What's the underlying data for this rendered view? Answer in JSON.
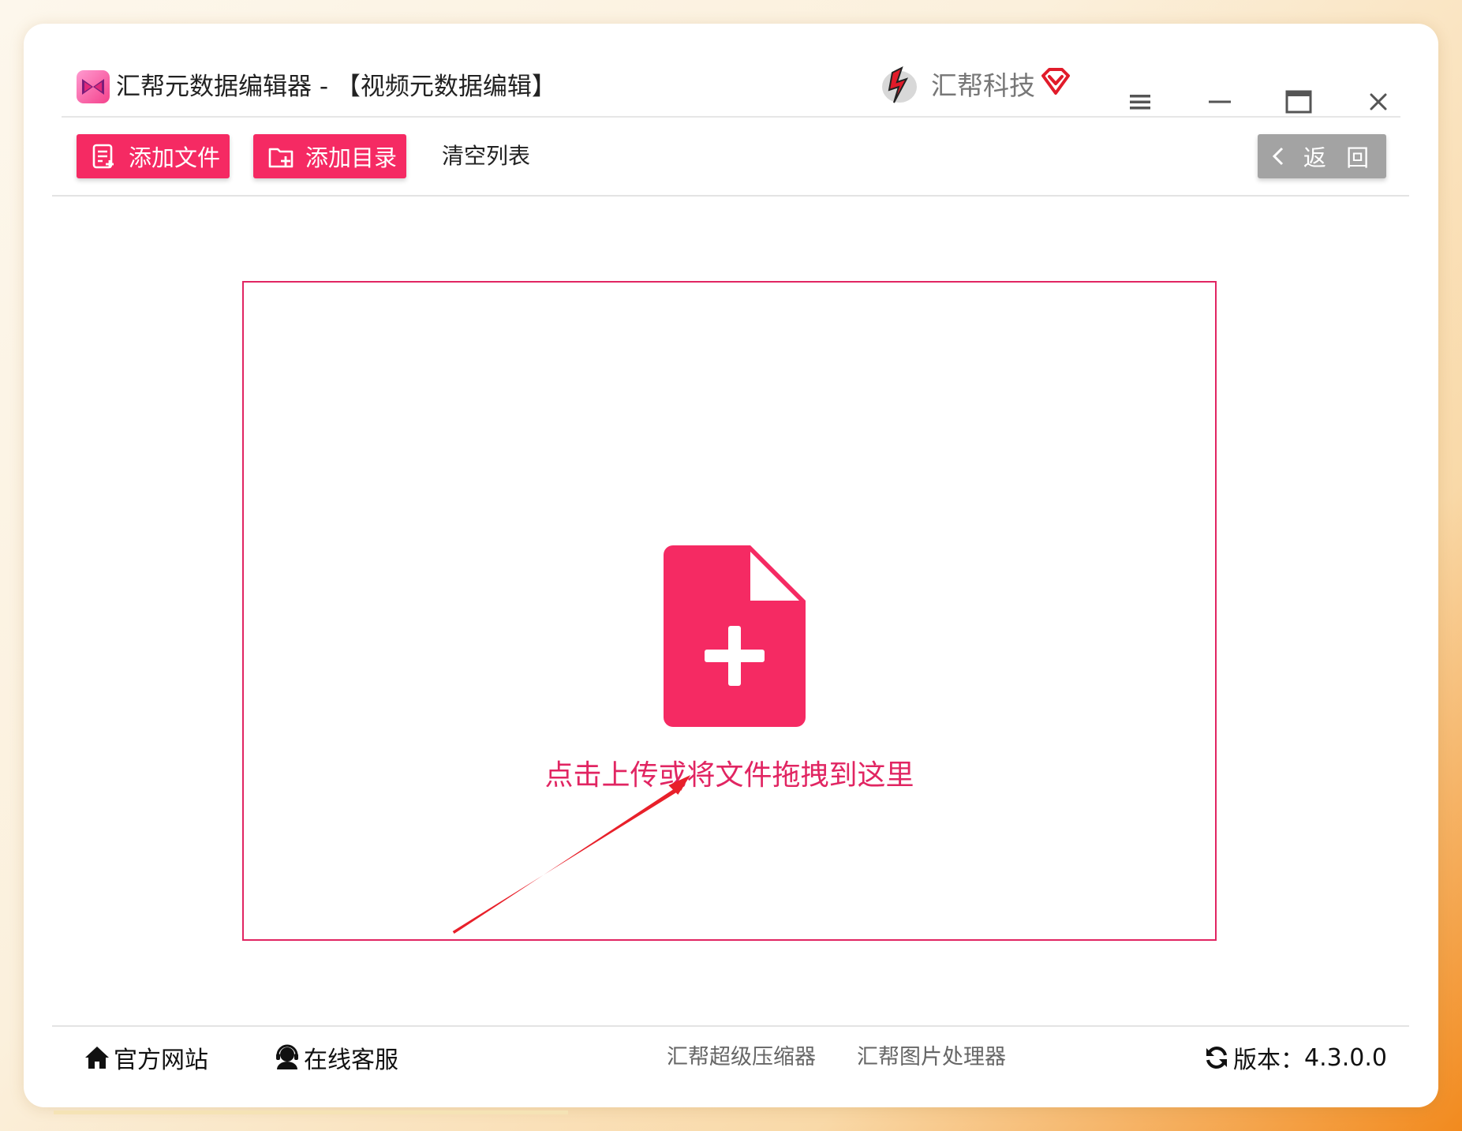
{
  "window": {
    "title": "汇帮元数据编辑器 - 【视频元数据编辑】",
    "brand_name": "汇帮科技",
    "icons": {
      "app": "app-logo-icon",
      "brand": "brand-logo-icon",
      "vip": "vip-diamond-icon",
      "menu": "menu-icon",
      "minimize": "minimize-icon",
      "maximize": "maximize-icon",
      "close": "close-icon"
    }
  },
  "toolbar": {
    "add_file_label": "添加文件",
    "add_folder_label": "添加目录",
    "clear_list_label": "清空列表",
    "back_label": "返 回"
  },
  "dropzone": {
    "prompt": "点击上传或将文件拖拽到这里"
  },
  "footer": {
    "official_site": "官方网站",
    "online_service": "在线客服",
    "link_compressor": "汇帮超级压缩器",
    "link_image_processor": "汇帮图片处理器",
    "version_label": "版本：",
    "version_value": "4.3.0.0"
  },
  "colors": {
    "accent": "#f52a63",
    "dropzone_border": "#e12562",
    "back_button": "#a3a3a3",
    "annotation_arrow": "#e8202a"
  }
}
